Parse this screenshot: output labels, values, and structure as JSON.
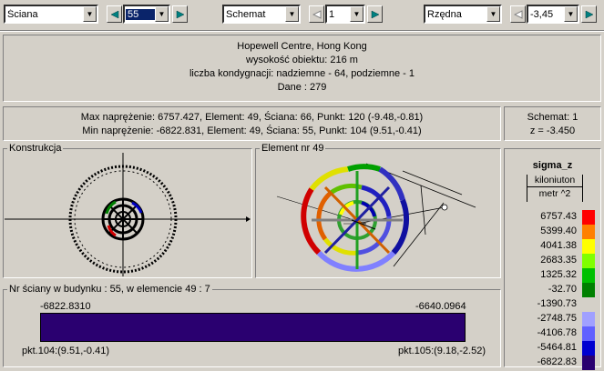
{
  "toolbar": {
    "element_type": "Ściana",
    "wall_number": "55",
    "schema": "Schemat",
    "schema_number": "1",
    "coordinate": "Rzędna",
    "coordinate_value": "-3,45"
  },
  "info": {
    "name": "Hopewell Centre, Hong Kong",
    "height": "wysokość obiektu: 216 m",
    "storeys": "liczba kondygnacji: nadziemne - 64, podziemne - 1",
    "data": "Dane :   279"
  },
  "stress": {
    "max": "Max naprężenie: 6757.427,   Element: 49,   Ściana: 66,   Punkt: 120 (-9.48,-0.81)",
    "min": "Min naprężenie: -6822.831,   Element: 49,   Ściana: 55,   Punkt: 104 (9.51,-0.41)"
  },
  "schema_info": {
    "line1": "Schemat: 1",
    "line2": "z = -3.450"
  },
  "panels": {
    "construction_label": "Konstrukcja",
    "element_label": "Element nr 49"
  },
  "wall": {
    "header": "Nr ściany w budynku :  55,   w elemencie 49 :  7",
    "left_value": "-6822.8310",
    "right_value": "-6640.0964",
    "left_point": "pkt.104:(9.51,-0.41)",
    "right_point": "pkt.105:(9.18,-2.52)",
    "bar_color": "#2a0070"
  },
  "legend": {
    "title": "sigma_z",
    "unit_top": "kiloniuton",
    "unit_bottom": "metr ^2",
    "rows": [
      {
        "value": "6757.43",
        "color": "#ff0000"
      },
      {
        "value": "5399.40",
        "color": "#ff8000"
      },
      {
        "value": "4041.38",
        "color": "#ffff00"
      },
      {
        "value": "2683.35",
        "color": "#80ff00"
      },
      {
        "value": "1325.32",
        "color": "#00c000"
      },
      {
        "value": "-32.70",
        "color": "#008000"
      },
      {
        "value": "-1390.73",
        "color": "#d4d0c8"
      },
      {
        "value": "-2748.75",
        "color": "#a0a0ff"
      },
      {
        "value": "-4106.78",
        "color": "#6060ff"
      },
      {
        "value": "-5464.81",
        "color": "#0000d0"
      },
      {
        "value": "-6822.83",
        "color": "#2a0070"
      }
    ]
  }
}
